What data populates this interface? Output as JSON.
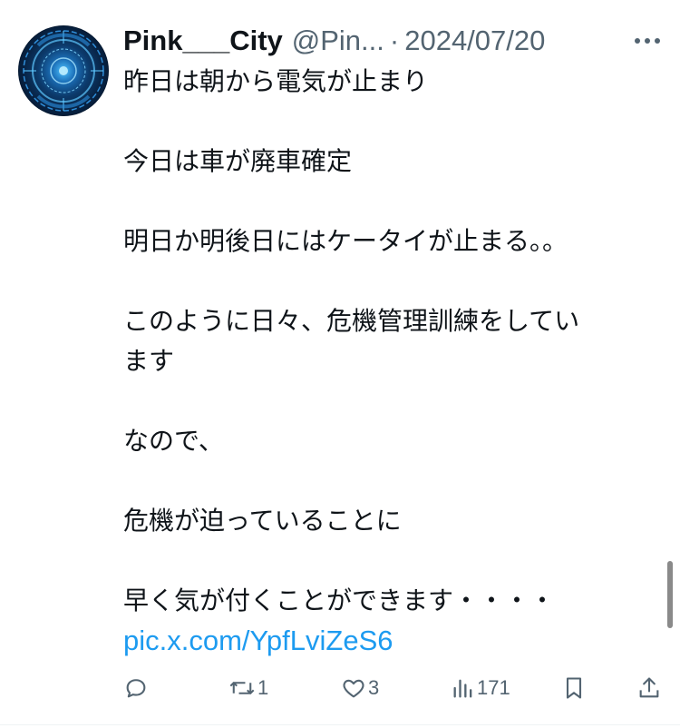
{
  "tweet": {
    "display_name": "Pink___City",
    "handle": "@Pin...",
    "separator": "·",
    "date": "2024/07/20",
    "more_icon": "more-horizontal-icon",
    "lines": [
      "昨日は朝から電気が止まり",
      "",
      "今日は車が廃車確定",
      "",
      "明日か明後日にはケータイが止まる。。",
      "",
      "このように日々、危機管理訓練をしてい",
      "ます",
      "",
      "なので、",
      "",
      "危機が迫っていることに",
      "",
      "早く気が付くことができます・・・・"
    ],
    "link": "pic.x.com/YpfLviZeS6"
  },
  "actions": {
    "reply": {
      "icon": "reply-icon",
      "count": ""
    },
    "retweet": {
      "icon": "retweet-icon",
      "count": "1"
    },
    "like": {
      "icon": "heart-icon",
      "count": "3"
    },
    "views": {
      "icon": "views-chart-icon",
      "count": "171"
    },
    "bookmark": {
      "icon": "bookmark-icon",
      "count": ""
    },
    "share": {
      "icon": "share-icon",
      "count": ""
    }
  },
  "colors": {
    "text": "#0f1419",
    "secondary": "#536471",
    "link": "#1d9bf0"
  }
}
